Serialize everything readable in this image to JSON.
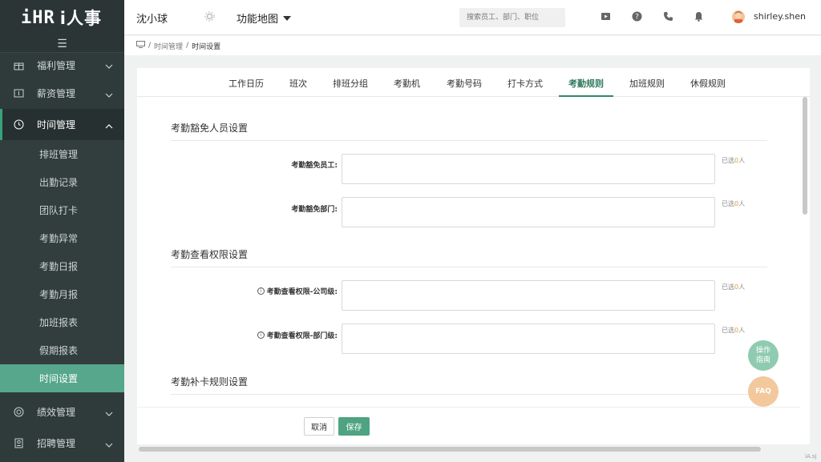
{
  "app": {
    "logo_prefix": "iHR",
    "logo_text": "i人事",
    "company": "沈小球",
    "function_map": "功能地图",
    "search_placeholder": "搜索员工、部门、职位",
    "username": "shirley.shen"
  },
  "sidebar": {
    "groups": [
      {
        "label": "福利管理",
        "icon": "gift-icon"
      },
      {
        "label": "薪资管理",
        "icon": "wallet-icon"
      },
      {
        "label": "时间管理",
        "icon": "clock-icon",
        "active": true
      },
      {
        "label": "绩效管理",
        "icon": "target-icon"
      },
      {
        "label": "招聘管理",
        "icon": "recruit-icon"
      }
    ],
    "sub_items": [
      {
        "label": "排班管理"
      },
      {
        "label": "出勤记录"
      },
      {
        "label": "团队打卡"
      },
      {
        "label": "考勤异常"
      },
      {
        "label": "考勤日报"
      },
      {
        "label": "考勤月报"
      },
      {
        "label": "加班报表"
      },
      {
        "label": "假期报表"
      },
      {
        "label": "时间设置",
        "selected": true
      }
    ]
  },
  "breadcrumb": {
    "items": [
      "时间管理",
      "时间设置"
    ],
    "separator": "/"
  },
  "tabs": [
    {
      "label": "工作日历"
    },
    {
      "label": "班次"
    },
    {
      "label": "排班分组"
    },
    {
      "label": "考勤机"
    },
    {
      "label": "考勤号码"
    },
    {
      "label": "打卡方式"
    },
    {
      "label": "考勤规则",
      "active": true
    },
    {
      "label": "加班规则"
    },
    {
      "label": "休假规则"
    }
  ],
  "sections": {
    "exempt": {
      "title": "考勤豁免人员设置",
      "fields": [
        {
          "label": "考勤豁免员工:",
          "count_prefix": "已选",
          "count": "0",
          "count_suffix": "人"
        },
        {
          "label": "考勤豁免部门:",
          "count_prefix": "已选",
          "count": "0",
          "count_suffix": "人"
        }
      ]
    },
    "permission": {
      "title": "考勤查看权限设置",
      "fields": [
        {
          "label": "考勤查看权限-公司级:",
          "count_prefix": "已选",
          "count": "0",
          "count_suffix": "人"
        },
        {
          "label": "考勤查看权限-部门级:",
          "count_prefix": "已选",
          "count": "0",
          "count_suffix": "人"
        }
      ]
    },
    "makeup": {
      "title": "考勤补卡规则设置"
    }
  },
  "actions": {
    "cancel": "取消",
    "save": "保存"
  },
  "floating": {
    "guide_line1": "操作",
    "guide_line2": "指南",
    "faq": "FAQ"
  },
  "corner_text": "iA.sj",
  "colors": {
    "accent": "#4fa382",
    "sidebar_bg": "#2f3a3a",
    "count_highlight": "#e0a040"
  }
}
